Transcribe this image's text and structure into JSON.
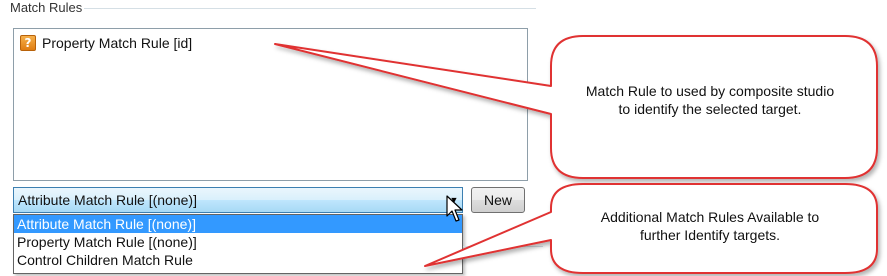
{
  "groupbox": {
    "title": "Match Rules"
  },
  "rules_list": {
    "items": [
      {
        "label": "Property Match Rule [id]",
        "icon": "question-rule-icon"
      }
    ]
  },
  "combo": {
    "value": "Attribute Match Rule [(none)]",
    "options": [
      "Attribute Match Rule [(none)]",
      "Property Match Rule [(none)]",
      "Control Children Match Rule"
    ],
    "selected_index": 0
  },
  "buttons": {
    "new_label": "New"
  },
  "callouts": [
    {
      "line1": "Match Rule to used by composite studio",
      "line2": "to identify the selected target."
    },
    {
      "line1": "Additional Match Rules Available to",
      "line2": "further Identify targets."
    }
  ],
  "colors": {
    "selection": "#3399ff",
    "callout_border": "#e03030",
    "icon_orange": "#e07d12"
  }
}
